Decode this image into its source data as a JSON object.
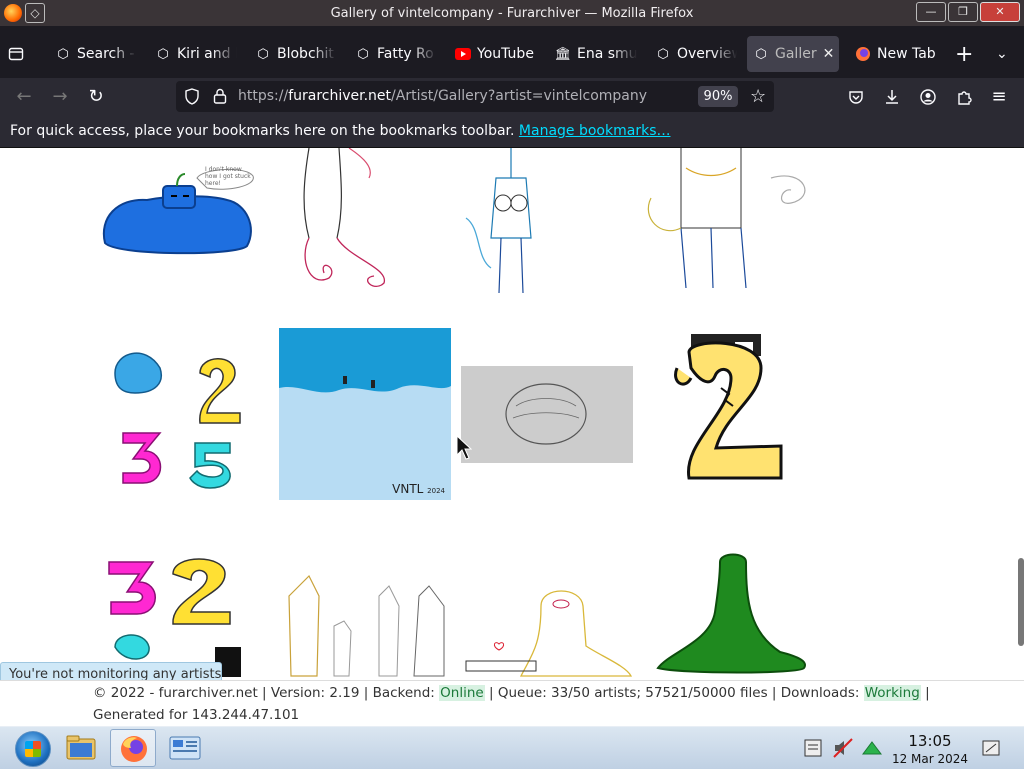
{
  "window": {
    "title": "Gallery of vintelcompany - Furarchiver — Mozilla Firefox"
  },
  "tabs": [
    {
      "label": "Search -",
      "icon": "furarchiver-icon"
    },
    {
      "label": "Kiri and l",
      "icon": "furarchiver-icon"
    },
    {
      "label": "Blobchit",
      "icon": "furarchiver-icon"
    },
    {
      "label": "Fatty Ro",
      "icon": "furarchiver-icon"
    },
    {
      "label": "YouTube",
      "icon": "youtube-icon"
    },
    {
      "label": "Ena smu",
      "icon": "museum-icon"
    },
    {
      "label": "Overview",
      "icon": "furarchiver-icon"
    },
    {
      "label": "Galler",
      "icon": "furarchiver-icon",
      "active": true
    },
    {
      "label": "New Tab",
      "icon": "firefox-icon"
    }
  ],
  "nav": {
    "url_prefix": "https://",
    "url_host": "furarchiver.net",
    "url_path": "/Artist/Gallery?artist=vintelcompany",
    "zoom": "90%"
  },
  "bookmarks": {
    "message": "For quick access, place your bookmarks here on the bookmarks toolbar.",
    "manage_link": "Manage bookmarks…"
  },
  "gallery": {
    "thumb_caption": "VNTL",
    "thumb_caption_year": "2024",
    "speech_text": "I don't know how I got stuck here!"
  },
  "notice": {
    "text": "You're not monitoring any artists"
  },
  "footer": {
    "copyright": "© 2022 - furarchiver.net | Version: 2.19 | Backend:",
    "backend_status": "Online",
    "queue": "| Queue: 33/50 artists; 57521/50000 files | Downloads:",
    "downloads_status": "Working",
    "end": "|",
    "generated": "Generated for 143.244.47.101"
  },
  "taskbar": {
    "time": "13:05",
    "date": "12 Mar 2024"
  },
  "colors": {
    "titlebar": "#3a3437",
    "tabbar": "#1c1b22",
    "navbar": "#2b2a33",
    "link": "#00ddff",
    "status_bg": "#d7f1e1"
  }
}
